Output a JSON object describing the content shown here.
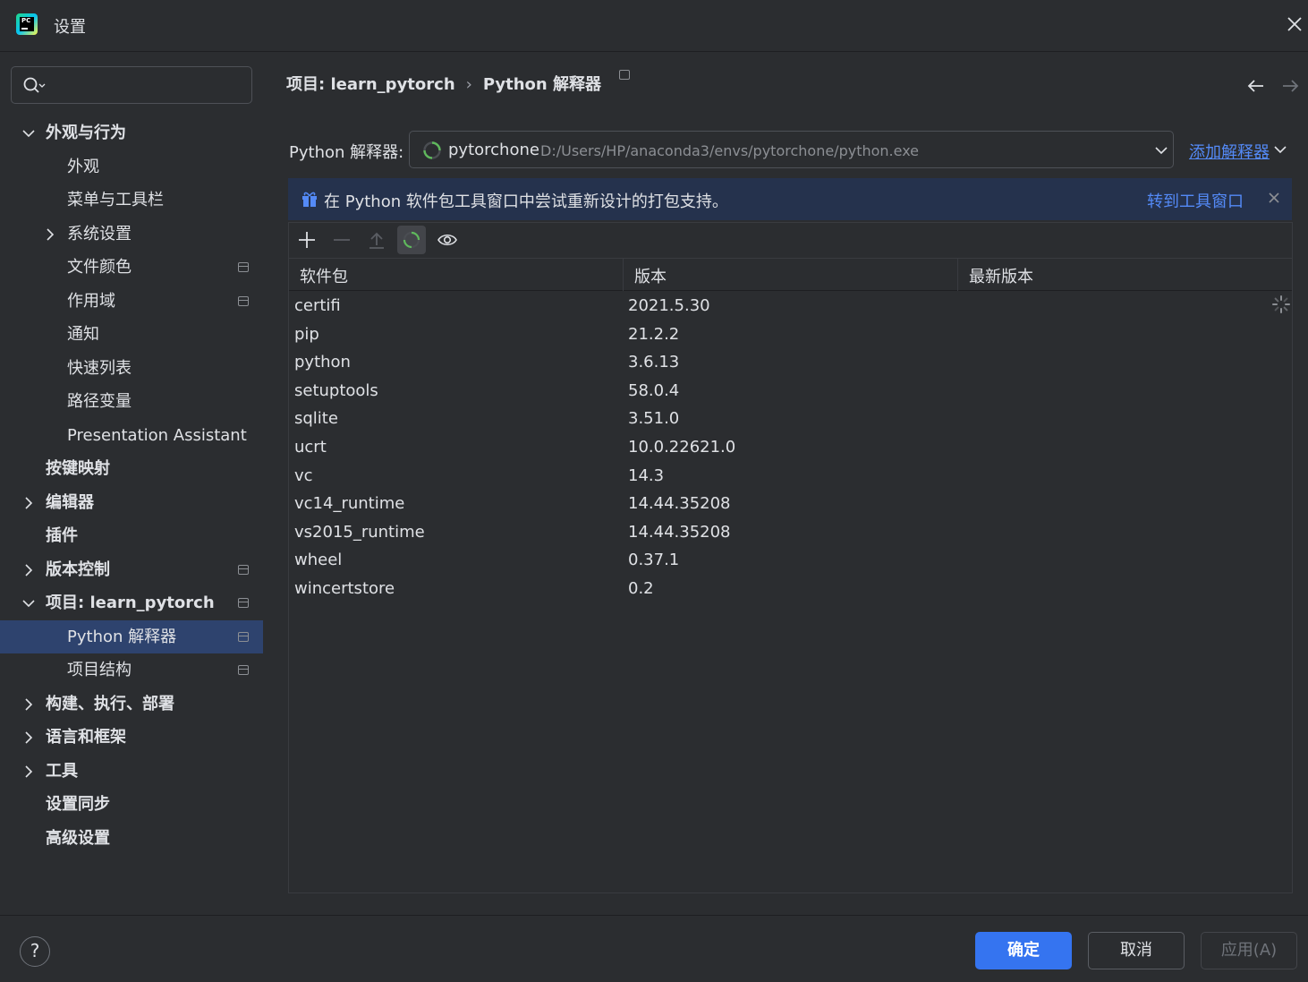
{
  "window": {
    "title": "设置",
    "logo_text": "PC"
  },
  "search": {
    "placeholder": ""
  },
  "sidebar": {
    "items": [
      {
        "label": "外观与行为",
        "level": 0,
        "bold": true,
        "chevron": "down"
      },
      {
        "label": "外观",
        "level": 1
      },
      {
        "label": "菜单与工具栏",
        "level": 1
      },
      {
        "label": "系统设置",
        "level": 1,
        "chevron": "right"
      },
      {
        "label": "文件颜色",
        "level": 1,
        "project_icon": true
      },
      {
        "label": "作用域",
        "level": 1,
        "project_icon": true
      },
      {
        "label": "通知",
        "level": 1
      },
      {
        "label": "快速列表",
        "level": 1
      },
      {
        "label": "路径变量",
        "level": 1
      },
      {
        "label": "Presentation Assistant",
        "level": 1
      },
      {
        "label": "按键映射",
        "level": 0,
        "bold": true
      },
      {
        "label": "编辑器",
        "level": 0,
        "bold": true,
        "chevron": "right"
      },
      {
        "label": "插件",
        "level": 0,
        "bold": true
      },
      {
        "label": "版本控制",
        "level": 0,
        "bold": true,
        "chevron": "right",
        "project_icon": true
      },
      {
        "label": "项目: learn_pytorch",
        "level": 0,
        "bold": true,
        "chevron": "down",
        "project_icon": true
      },
      {
        "label": "Python 解释器",
        "level": 1,
        "selected": true,
        "project_icon": true
      },
      {
        "label": "项目结构",
        "level": 1,
        "project_icon": true
      },
      {
        "label": "构建、执行、部署",
        "level": 0,
        "bold": true,
        "chevron": "right"
      },
      {
        "label": "语言和框架",
        "level": 0,
        "bold": true,
        "chevron": "right"
      },
      {
        "label": "工具",
        "level": 0,
        "bold": true,
        "chevron": "right"
      },
      {
        "label": "设置同步",
        "level": 0,
        "bold": true
      },
      {
        "label": "高级设置",
        "level": 0,
        "bold": true
      }
    ]
  },
  "breadcrumb": {
    "project": "项目: learn_pytorch",
    "separator": "›",
    "page": "Python 解释器"
  },
  "interpreter": {
    "label": "Python 解释器:",
    "env_name": "pytorchone",
    "env_path": "D:/Users/HP/anaconda3/envs/pytorchone/python.exe",
    "add_label": "添加解释器"
  },
  "banner": {
    "message": "在 Python 软件包工具窗口中尝试重新设计的打包支持。",
    "link": "转到工具窗口"
  },
  "table": {
    "columns": [
      "软件包",
      "版本",
      "最新版本"
    ],
    "rows": [
      {
        "name": "certifi",
        "version": "2021.5.30",
        "latest": ""
      },
      {
        "name": "pip",
        "version": "21.2.2",
        "latest": ""
      },
      {
        "name": "python",
        "version": "3.6.13",
        "latest": ""
      },
      {
        "name": "setuptools",
        "version": "58.0.4",
        "latest": ""
      },
      {
        "name": "sqlite",
        "version": "3.51.0",
        "latest": ""
      },
      {
        "name": "ucrt",
        "version": "10.0.22621.0",
        "latest": ""
      },
      {
        "name": "vc",
        "version": "14.3",
        "latest": ""
      },
      {
        "name": "vc14_runtime",
        "version": "14.44.35208",
        "latest": ""
      },
      {
        "name": "vs2015_runtime",
        "version": "14.44.35208",
        "latest": ""
      },
      {
        "name": "wheel",
        "version": "0.37.1",
        "latest": ""
      },
      {
        "name": "wincertstore",
        "version": "0.2",
        "latest": ""
      }
    ]
  },
  "footer": {
    "help": "?",
    "ok": "确定",
    "cancel": "取消",
    "apply": "应用(A)"
  },
  "colors": {
    "background": "#2b2d30",
    "selection": "#2e436e",
    "accent": "#3574f0",
    "link": "#548af7",
    "banner": "#25324d"
  }
}
